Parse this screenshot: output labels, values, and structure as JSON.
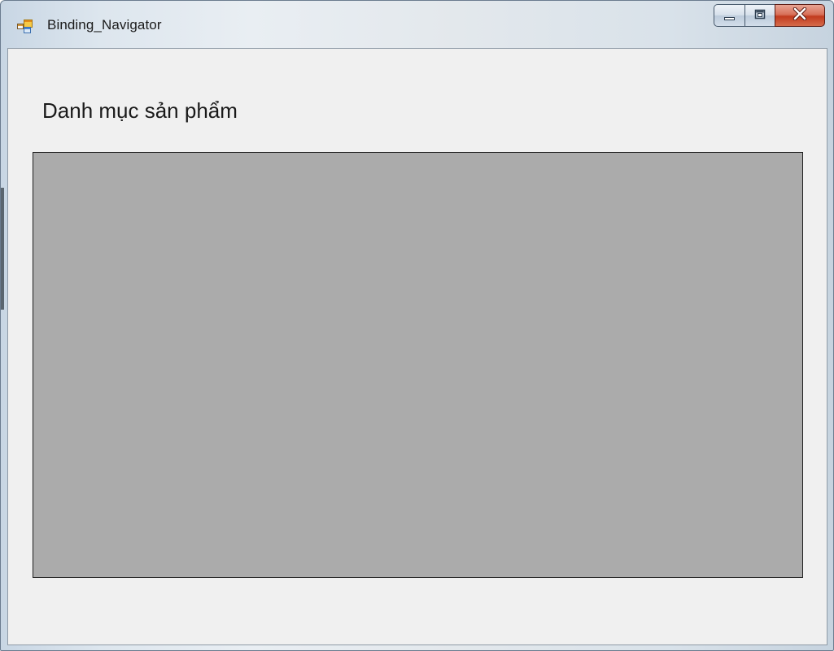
{
  "window": {
    "title": "Binding_Navigator",
    "icons": {
      "app": "winforms-app-icon",
      "minimize": "minimize-icon",
      "maximize": "maximize-icon",
      "close": "close-icon"
    },
    "colors": {
      "client_background": "#f0f0f0",
      "grid_background": "#ababab",
      "close_button": "#c7472b"
    }
  },
  "form": {
    "heading": "Danh mục sản phẩm"
  }
}
